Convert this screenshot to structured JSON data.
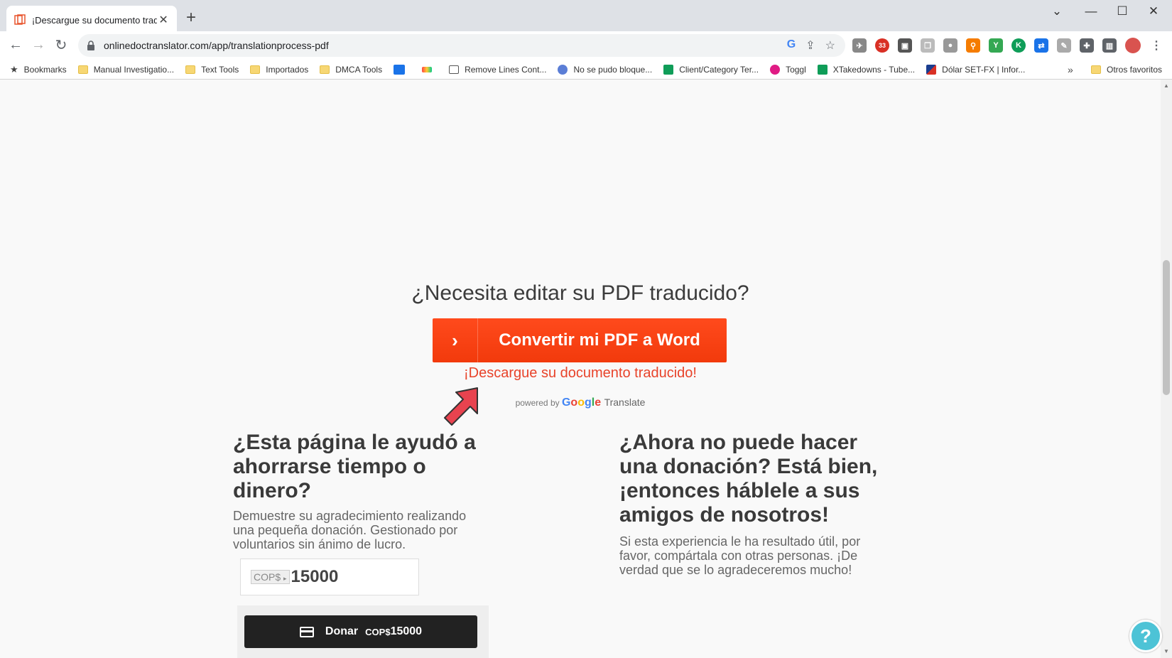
{
  "browser": {
    "tab_title": "¡Descargue su documento traducido",
    "url": "onlinedoctranslator.com/app/translationprocess-pdf",
    "ext_badge": "33",
    "bookmarks": [
      {
        "label": "Bookmarks",
        "icon": "star-icon"
      },
      {
        "label": "Manual Investigatio...",
        "icon": "folder-icon"
      },
      {
        "label": "Text Tools",
        "icon": "folder-icon"
      },
      {
        "label": "Importados",
        "icon": "folder-icon"
      },
      {
        "label": "DMCA Tools",
        "icon": "folder-icon"
      },
      {
        "label": "Remove Lines Cont...",
        "icon": "text-tool-icon"
      },
      {
        "label": "No se pudo bloque...",
        "icon": "globe-icon"
      },
      {
        "label": "Client/Category Ter...",
        "icon": "sheets-icon"
      },
      {
        "label": "Toggl",
        "icon": "toggl-icon"
      },
      {
        "label": "XTakedowns - Tube...",
        "icon": "sheets-icon"
      },
      {
        "label": "Dólar SET-FX | Infor...",
        "icon": "chart-icon"
      }
    ],
    "other_bookmarks": "Otros favoritos",
    "more_symbol": "»"
  },
  "page": {
    "edit_title": "¿Necesita editar su PDF traducido?",
    "convert_button": "Convertir mi PDF a Word",
    "download_link": "¡Descargue su documento traducido!",
    "powered_by": "powered by",
    "google": "Google",
    "translate": "Translate",
    "left_heading": "¿Esta página le ayudó a ahorrarse tiempo o dinero?",
    "left_text": "Demuestre su agradecimiento realizando una pequeña donación. Gestionado por voluntarios sin ánimo de lucro.",
    "currency": "COP$",
    "amount": "15000",
    "donate_label": "Donar",
    "donate_currency": "COP$",
    "donate_amount": "15000",
    "right_heading": "¿Ahora no puede hacer una donación? Está bien, ¡entonces háblele a sus amigos de nosotros!",
    "right_text": "Si esta experiencia le ha resultado útil, por favor, compártala con otras personas. ¡De verdad que se lo agradeceremos mucho!"
  },
  "colors": {
    "accent": "#f23a0c",
    "link": "#e8432a",
    "annotation_arrow": "#e8434f"
  }
}
